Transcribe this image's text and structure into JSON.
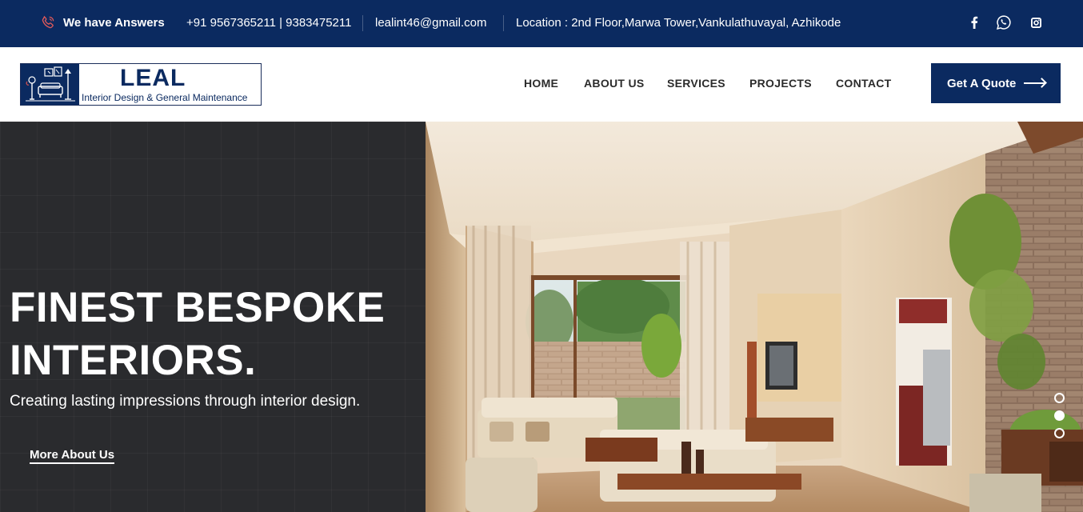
{
  "topbar": {
    "tagline": "We have Answers",
    "phones": "+91 9567365211 | 9383475211",
    "email": "lealint46@gmail.com",
    "location": "Location : 2nd Floor,Marwa Tower,Vankulathuvayal, Azhikode",
    "social_icons": [
      "facebook-icon",
      "whatsapp-icon",
      "instagram-icon"
    ]
  },
  "logo": {
    "title": "LEAL",
    "subtitle": "Interior Design & General Maintenance"
  },
  "nav": {
    "items": [
      "HOME",
      "ABOUT US",
      "SERVICES",
      "PROJECTS",
      "CONTACT"
    ],
    "cta": "Get A Quote"
  },
  "hero": {
    "title_line1": "FINEST BESPOKE",
    "title_line2": "INTERIORS.",
    "subtitle": "Creating lasting impressions through interior design.",
    "link": "More About Us",
    "slides": 3,
    "active_slide": 2
  },
  "colors": {
    "navy": "#0b2a60",
    "hero_dark": "#2a2b2e",
    "phone_icon": "#e05a5a"
  }
}
